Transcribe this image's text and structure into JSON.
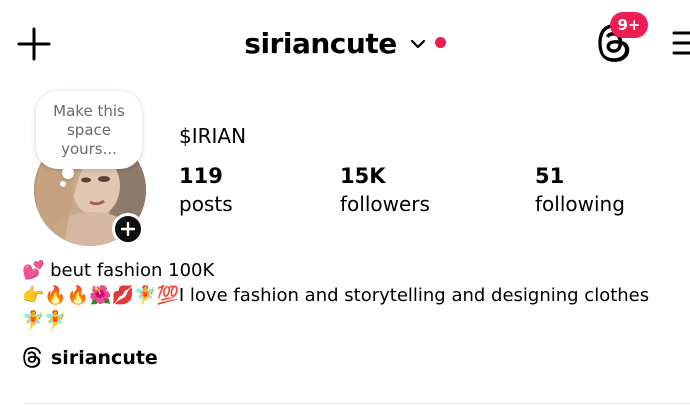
{
  "header": {
    "username": "siriancute",
    "notification_badge": "9+",
    "icons": {
      "create": "plus-icon",
      "account_switcher": "chevron-down-icon",
      "threads": "threads-icon",
      "menu": "hamburger-menu-icon"
    }
  },
  "note": {
    "text": "Make this space yours..."
  },
  "profile": {
    "display_name": "$IRIAN",
    "stats": [
      {
        "value": "119",
        "label": "posts"
      },
      {
        "value": "15K",
        "label": "followers"
      },
      {
        "value": "51",
        "label": "following"
      }
    ]
  },
  "bio": {
    "line1": "💕 beut fashion 100K",
    "line2": "👉🔥🔥🌺💋🧚💯I love fashion   and storytelling and designing clothes",
    "line3": "🧚🧚"
  },
  "threads_link": {
    "handle": "siriancute"
  },
  "colors": {
    "accent_red": "#ee1d52",
    "badge_red": "#ee1d52",
    "text": "#000000",
    "note_text": "#6b6b6b"
  }
}
